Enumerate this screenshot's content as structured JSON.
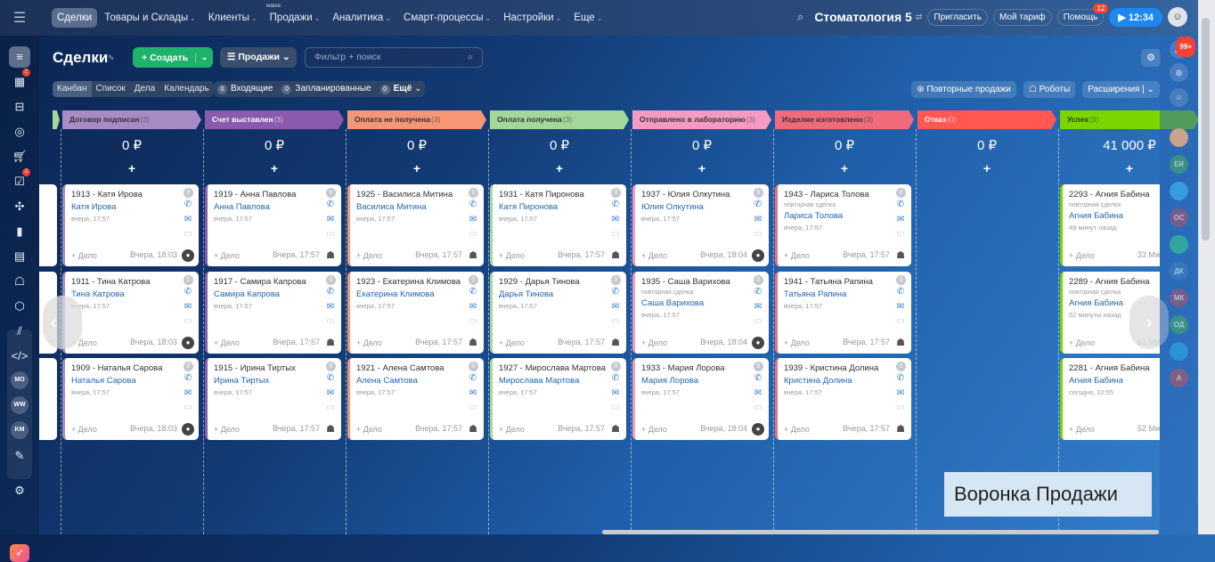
{
  "topbar": {
    "menu_icon": "burger-icon",
    "nav": [
      {
        "label": "Сделки",
        "active": true
      },
      {
        "label": "Товары и Склады",
        "chevron": true
      },
      {
        "label": "Клиенты",
        "chevron": true
      },
      {
        "label": "Продажи",
        "chevron": true,
        "new_label": "новое"
      },
      {
        "label": "Аналитика",
        "chevron": true
      },
      {
        "label": "Смарт-процессы",
        "chevron": true
      },
      {
        "label": "Настройки",
        "chevron": true
      },
      {
        "label": "Еще",
        "chevron": true
      }
    ],
    "portal": "Стоматология 5",
    "invite": "Пригласить",
    "tariff": "Мой тариф",
    "help": "Помощь",
    "help_badge": "12",
    "timer": "12:34"
  },
  "leftbar": {
    "tasks_badge": "1",
    "checklist_badge": "2",
    "circles": [
      "MO",
      "WW",
      "KM"
    ]
  },
  "toolbar": {
    "title": "Сделки",
    "create": "Создать",
    "funnel": "Продажи",
    "search_placeholder": "Фильтр + поиск",
    "views": [
      "Канбан",
      "Список",
      "Дела",
      "Календарь"
    ],
    "counters": [
      {
        "n": "0",
        "label": "Входящие"
      },
      {
        "n": "0",
        "label": "Запланированные"
      },
      {
        "n": "0",
        "label": "Ещё"
      }
    ],
    "repeat_sales": "Повторные продажи",
    "robots": "Роботы",
    "extensions": "Расширения"
  },
  "rightbar": {
    "notif_badge": "99+",
    "items": [
      "ЕИ",
      "",
      "ОС",
      "",
      "ДК",
      "МК",
      "ОД",
      "",
      "А"
    ]
  },
  "stages": [
    {
      "name": "Договор подписан",
      "count": "(3)",
      "color": "#a78bc5",
      "text": "#333",
      "sum": "0 ₽",
      "cards": [
        {
          "title": "1913 - Катя Ирова",
          "contact": "Катя Ирова",
          "date": "вчера, 17:57",
          "time": "Вчера, 18:03",
          "av": "user"
        },
        {
          "title": "1911 - Тина Катрова",
          "contact": "Тина Катрова",
          "date": "вчера, 17:57",
          "time": "Вчера, 18:03",
          "av": "user"
        },
        {
          "title": "1909 - Наталья Сарова",
          "contact": "Наталья Сарова",
          "date": "вчера, 17:57",
          "time": "Вчера, 18:03",
          "av": "user"
        }
      ]
    },
    {
      "name": "Счет выставлен",
      "count": "(3)",
      "color": "#8a5aae",
      "text": "#fff",
      "sum": "0 ₽",
      "cards": [
        {
          "title": "1919 - Анна Павлова",
          "contact": "Анна Павлова",
          "date": "вчера, 17:57",
          "time": "Вчера, 17:57",
          "av": "robot"
        },
        {
          "title": "1917 - Самира Капрова",
          "contact": "Самира Капрова",
          "date": "вчера, 17:57",
          "time": "Вчера, 17:57",
          "av": "robot"
        },
        {
          "title": "1915 - Ирина Тиртых",
          "contact": "Ирина Тиртых",
          "date": "вчера, 17:57",
          "time": "Вчера, 17:57",
          "av": "robot"
        }
      ]
    },
    {
      "name": "Оплата не получена",
      "count": "(3)",
      "color": "#f59677",
      "text": "#333",
      "sum": "0 ₽",
      "cards": [
        {
          "title": "1925 - Василиса Митина",
          "contact": "Василиса Митина",
          "date": "вчера, 17:57",
          "time": "Вчера, 17:57",
          "av": "robot"
        },
        {
          "title": "1923 - Екатерина Климова",
          "contact": "Екатерина Климова",
          "date": "вчера, 17:57",
          "time": "Вчера, 17:57",
          "av": "robot"
        },
        {
          "title": "1921 - Алена Самтова",
          "contact": "Алена Самтова",
          "date": "вчера, 17:57",
          "time": "Вчера, 17:57",
          "av": "robot"
        }
      ]
    },
    {
      "name": "Оплата получена",
      "count": "(3)",
      "color": "#a3d89a",
      "text": "#333",
      "sum": "0 ₽",
      "cards": [
        {
          "title": "1931 - Катя Пиронова",
          "contact": "Катя Пиронова",
          "date": "вчера, 17:57",
          "time": "Вчера, 17:57",
          "av": "robot"
        },
        {
          "title": "1929 - Дарья Тинова",
          "contact": "Дарья Тинова",
          "date": "вчера, 17:57",
          "time": "Вчера, 17:57",
          "av": "robot"
        },
        {
          "title": "1927 - Мирослава Мартова",
          "contact": "Мирослава Мартова",
          "date": "вчера, 17:57",
          "time": "Вчера, 17:57",
          "av": "robot"
        }
      ]
    },
    {
      "name": "Отправлено в лабораторию",
      "count": "(3)",
      "color": "#f59ac5",
      "text": "#333",
      "sum": "0 ₽",
      "cards": [
        {
          "title": "1937 - Юлия Олкутина",
          "contact": "Юлия Олкутина",
          "date": "вчера, 17:57",
          "time": "Вчера, 18:04",
          "av": "user"
        },
        {
          "title": "1935 - Саша Варихова",
          "repeat": "повторная сделка",
          "contact": "Саша Варихова",
          "date": "вчера, 17:57",
          "time": "Вчера, 18:04",
          "av": "user"
        },
        {
          "title": "1933 - Мария Лорова",
          "contact": "Мария Лорова",
          "date": "вчера, 17:57",
          "time": "Вчера, 18:04",
          "av": "user"
        }
      ]
    },
    {
      "name": "Изделие изготовлено",
      "count": "(3)",
      "color": "#ef6b7c",
      "text": "#333",
      "sum": "0 ₽",
      "cards": [
        {
          "title": "1943 - Лариса Толова",
          "repeat": "повторная сделка",
          "contact": "Лариса Толова",
          "date": "вчера, 17:57",
          "time": "Вчера, 17:57",
          "av": "robot"
        },
        {
          "title": "1941 - Татьяна Рапина",
          "contact": "Татьяна Рапина",
          "date": "вчера, 17:57",
          "time": "Вчера, 17:57",
          "av": "robot"
        },
        {
          "title": "1939 - Кристина Долина",
          "contact": "Кристина Долина",
          "date": "вчера, 17:57",
          "time": "Вчера, 17:57",
          "av": "robot"
        }
      ]
    },
    {
      "name": "Отказ",
      "count": "(0)",
      "color": "#ff5752",
      "text": "#fff",
      "sum": "0 ₽",
      "cards": []
    },
    {
      "name": "Успех",
      "count": "(3)",
      "color": "#7bd500",
      "text": "#333",
      "sum": "41 000 ₽",
      "cards": [
        {
          "title": "2293 - Агния Бабина",
          "repeat": "повторная сделка",
          "contact": "Агния Бабина",
          "date": "48 минут назад",
          "time": "33 Ми"
        },
        {
          "title": "2289 - Агния Бабина",
          "repeat": "повторная сделка",
          "contact": "Агния Бабина",
          "date": "52 минуты назад",
          "time": "51 Ми"
        },
        {
          "title": "2281 - Агния Бабина",
          "contact": "Агния Бабина",
          "date": "сегодня, 10:55",
          "time": "52 Ми"
        }
      ]
    }
  ],
  "card_labels": {
    "zero": "0",
    "add_activity": "+ Дело",
    "plus": "+"
  },
  "overlay_label": "Воронка Продажи"
}
